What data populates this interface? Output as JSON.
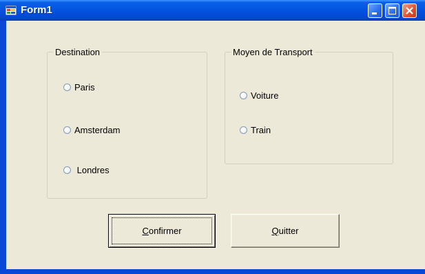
{
  "window": {
    "title": "Form1",
    "controls": {
      "minimize": "minimize",
      "maximize": "maximize",
      "close": "close"
    }
  },
  "destination": {
    "label": "Destination",
    "options": [
      {
        "label": "Paris",
        "checked": false
      },
      {
        "label": "Amsterdam",
        "checked": false
      },
      {
        "label": " Londres",
        "checked": false
      }
    ]
  },
  "transport": {
    "label": "Moyen de Transport",
    "options": [
      {
        "label": "Voiture",
        "checked": false
      },
      {
        "label": "Train",
        "checked": false
      }
    ]
  },
  "buttons": {
    "confirm": {
      "accel": "C",
      "rest": "onfirmer"
    },
    "quit": {
      "accel": "Q",
      "rest": "uitter"
    }
  },
  "colors": {
    "titlebar": "#0453df",
    "face": "#ece9d8",
    "group_border": "#d0d0bf",
    "radio_border": "#7f9db9"
  }
}
